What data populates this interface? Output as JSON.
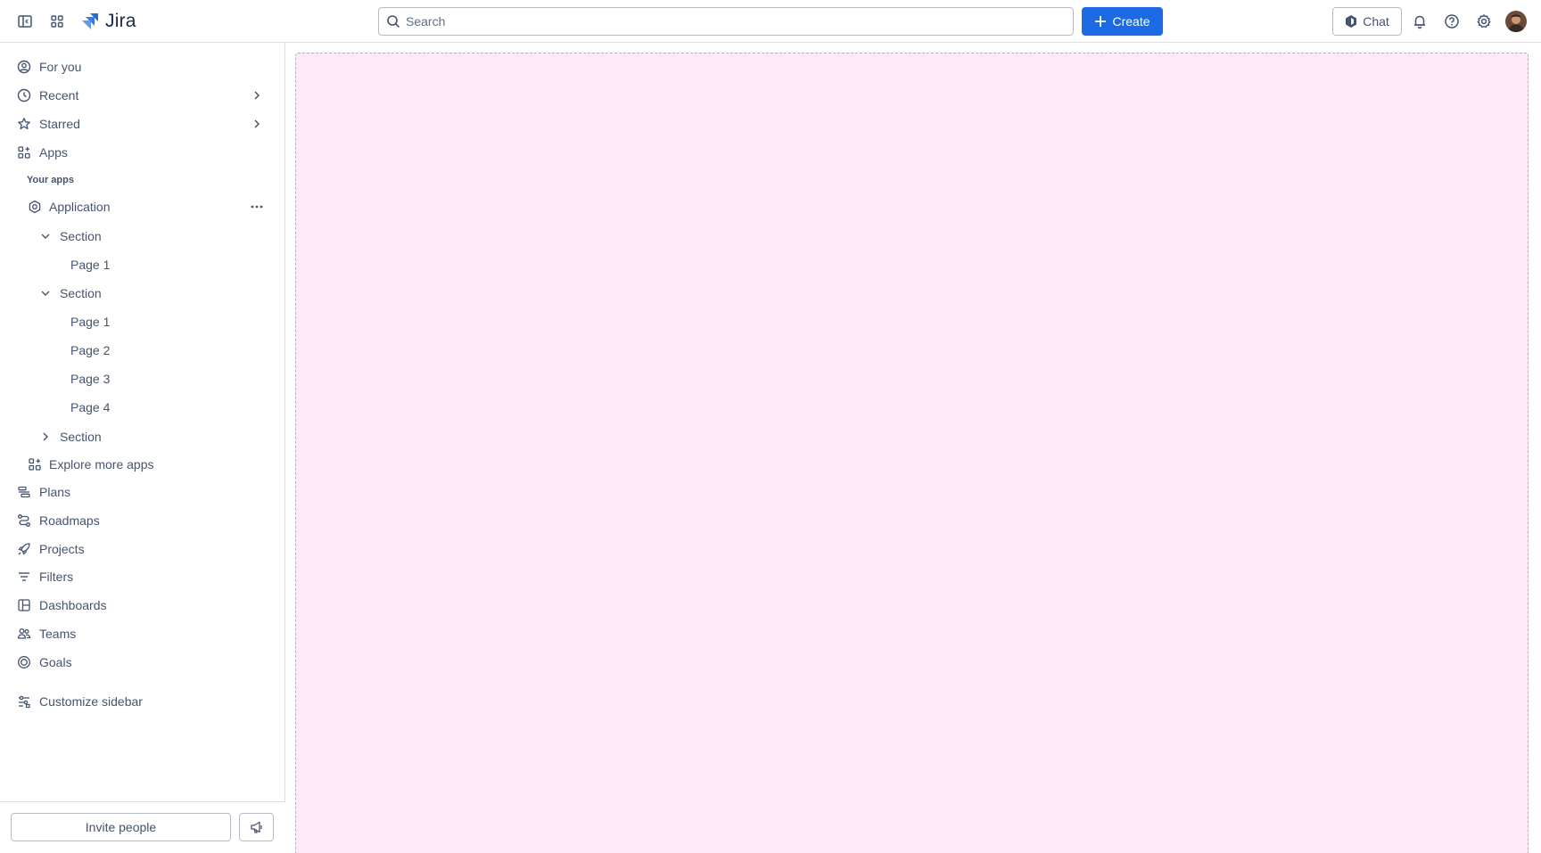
{
  "app": {
    "name": "Jira",
    "brand_color": "#1d6ae5"
  },
  "topnav": {
    "sidebar_toggle_icon": "sidebar-toggle-icon",
    "app_switcher_icon": "app-switcher-icon",
    "search": {
      "placeholder": "Search",
      "value": ""
    },
    "create_label": "Create",
    "chat_label": "Chat",
    "notifications_icon": "bell-icon",
    "help_icon": "help-icon",
    "settings_icon": "gear-icon"
  },
  "sidebar": {
    "items": [
      {
        "label": "For you",
        "icon": "user-circle-icon"
      },
      {
        "label": "Recent",
        "icon": "clock-icon"
      },
      {
        "label": "Starred",
        "icon": "star-icon"
      },
      {
        "label": "Apps",
        "icon": "apps-icon"
      }
    ],
    "your_apps_header": "Your apps",
    "application": {
      "label": "Application",
      "sections": [
        {
          "label": "Section",
          "expanded": true,
          "pages": [
            "Page 1"
          ]
        },
        {
          "label": "Section",
          "expanded": true,
          "pages": [
            "Page 1",
            "Page 2",
            "Page 3",
            "Page 4"
          ]
        },
        {
          "label": "Section",
          "expanded": false,
          "pages": []
        }
      ]
    },
    "explore_more_apps": "Explore more apps",
    "more_items": [
      {
        "label": "Plans",
        "icon": "plans-icon"
      },
      {
        "label": "Roadmaps",
        "icon": "roadmaps-icon"
      },
      {
        "label": "Projects",
        "icon": "rocket-icon"
      },
      {
        "label": "Filters",
        "icon": "filter-icon"
      },
      {
        "label": "Dashboards",
        "icon": "dashboard-icon"
      },
      {
        "label": "Teams",
        "icon": "teams-icon"
      },
      {
        "label": "Goals",
        "icon": "goal-icon"
      }
    ],
    "customize_label": "Customize sidebar",
    "invite_label": "Invite people",
    "feedback_icon": "megaphone-icon"
  },
  "main": {
    "placeholder_color": "#fde9f7"
  }
}
